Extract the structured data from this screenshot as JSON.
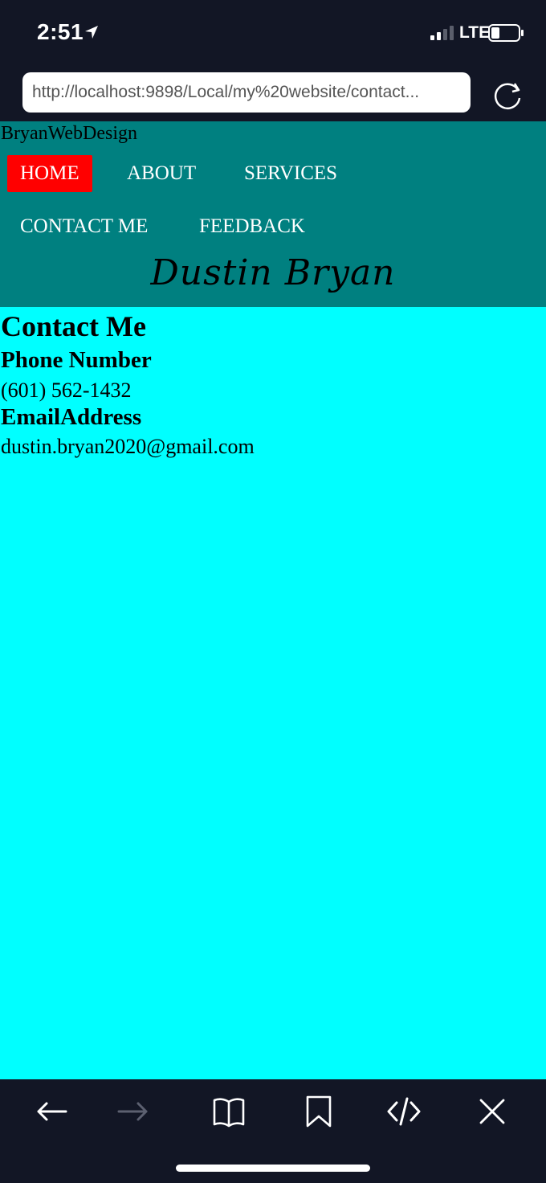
{
  "status_bar": {
    "time": "2:51",
    "network": "LTE"
  },
  "browser": {
    "url": "http://localhost:9898/Local/my%20website/contact..."
  },
  "site": {
    "brand": "BryanWebDesign",
    "nav": [
      {
        "label": "HOME",
        "active": true
      },
      {
        "label": "ABOUT",
        "active": false
      },
      {
        "label": "SERVICES",
        "active": false
      },
      {
        "label": "CONTACT ME",
        "active": false
      },
      {
        "label": "FEEDBACK",
        "active": false
      }
    ],
    "signature": "Dustin Bryan"
  },
  "content": {
    "heading": "Contact Me",
    "phone_label": "Phone Number",
    "phone_value": "(601) 562-1432",
    "email_label": "EmailAddress",
    "email_value": "dustin.bryan2020@gmail.com"
  },
  "colors": {
    "page_background": "#00ffff",
    "header_background": "#008080",
    "active_nav": "#ff0000",
    "chrome_background": "#121625"
  },
  "icons": {
    "status": [
      "location-arrow-icon",
      "signal-bars-icon",
      "battery-icon"
    ],
    "url_bar": [
      "reload-icon"
    ],
    "toolbar": [
      "back-arrow-icon",
      "forward-arrow-icon",
      "bookmarks-book-icon",
      "bookmark-icon",
      "code-icon",
      "close-icon"
    ]
  }
}
